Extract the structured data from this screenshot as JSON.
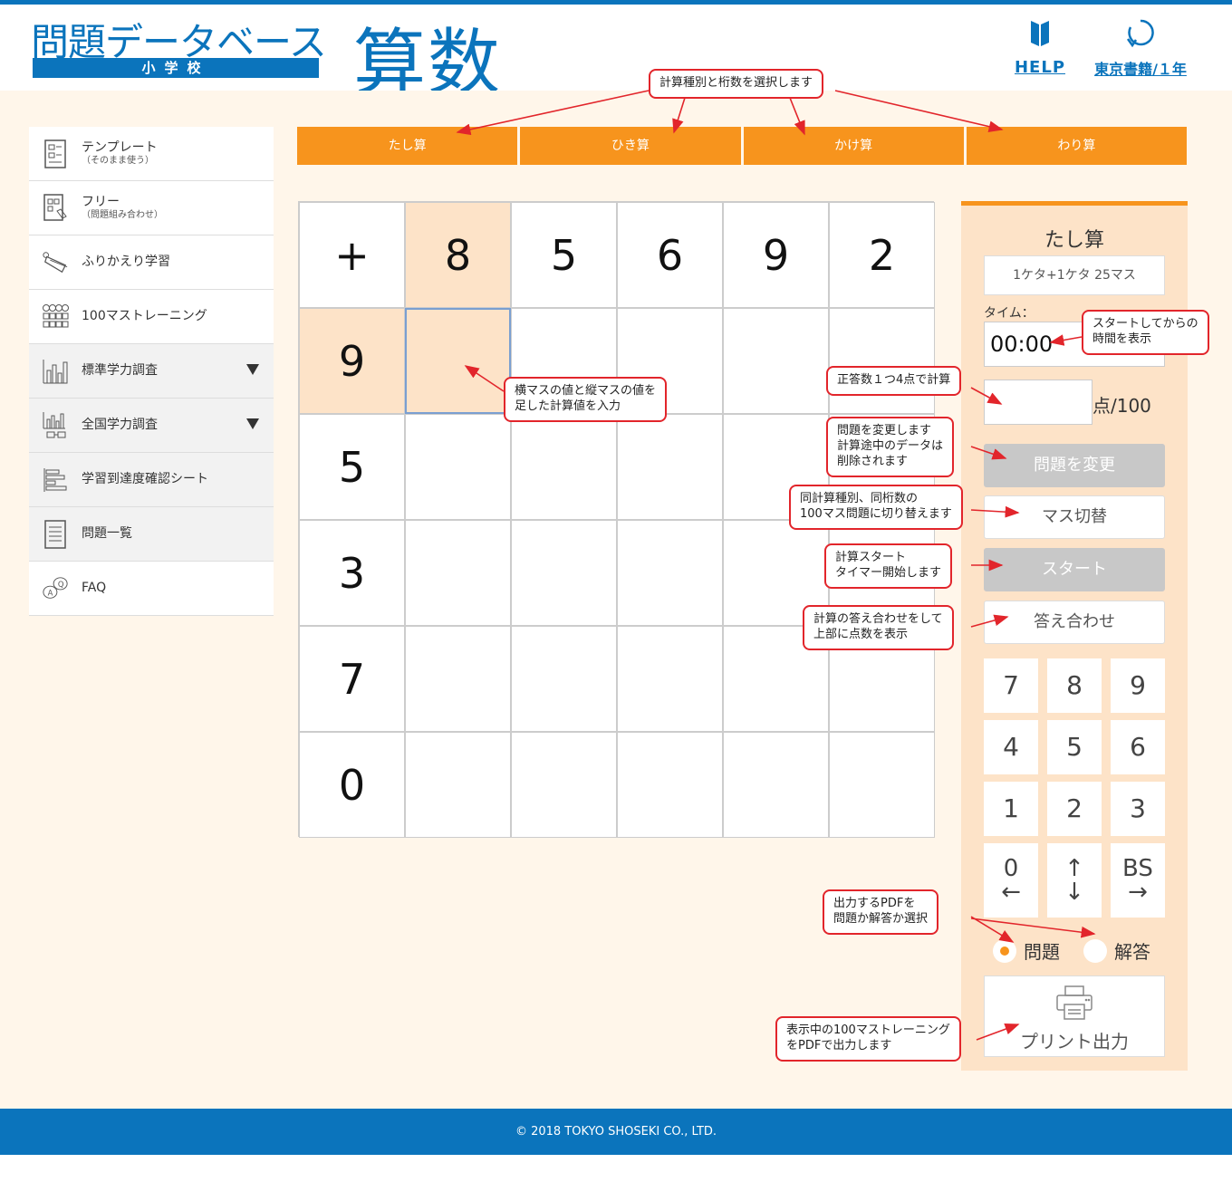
{
  "header": {
    "logo_title": "問題データベース",
    "logo_sub": "小学校",
    "subject": "算数",
    "help_label": "HELP",
    "book_label": "東京書籍/１年"
  },
  "sidebar": {
    "items": [
      {
        "label": "テンプレート",
        "sub": "（そのまま使う）"
      },
      {
        "label": "フリー",
        "sub": "（問題組み合わせ）"
      },
      {
        "label": "ふりかえり学習",
        "sub": ""
      },
      {
        "label": "100マストレーニング",
        "sub": ""
      },
      {
        "label": "標準学力調査",
        "sub": ""
      },
      {
        "label": "全国学力調査",
        "sub": ""
      },
      {
        "label": "学習到達度確認シート",
        "sub": ""
      },
      {
        "label": "問題一覧",
        "sub": ""
      },
      {
        "label": "FAQ",
        "sub": ""
      }
    ]
  },
  "tabs": [
    "たし算",
    "ひき算",
    "かけ算",
    "わり算"
  ],
  "grid": {
    "operator": "+",
    "columns": [
      "8",
      "5",
      "6",
      "9",
      "2"
    ],
    "rows": [
      "9",
      "5",
      "3",
      "7",
      "0"
    ]
  },
  "panel": {
    "title": "たし算",
    "description": "1ケタ+1ケタ 25マス",
    "time_label": "タイム：",
    "time_value": "00:00",
    "score_unit": "点/100",
    "change_button": "問題を変更",
    "switch_button": "マス切替",
    "start_button": "スタート",
    "check_button": "答え合わせ",
    "keys": [
      "7",
      "8",
      "9",
      "4",
      "5",
      "6",
      "1",
      "2",
      "3"
    ],
    "key_zero": "0",
    "key_left": "←",
    "key_up": "↑",
    "key_down": "↓",
    "key_bs": "BS",
    "key_right": "→",
    "radio_question": "問題",
    "radio_answer": "解答",
    "print_button": "プリント出力"
  },
  "callouts": {
    "select_type": "計算種別と桁数を選択します",
    "input_hint_1": "横マスの値と縦マスの値を",
    "input_hint_2": "足した計算値を入力",
    "timer_1": "スタートしてからの",
    "timer_2": "時間を表示",
    "score": "正答数１つ4点で計算",
    "change_1": "問題を変更します",
    "change_2": "計算途中のデータは",
    "change_3": "削除されます",
    "switch_1": "同計算種別、同桁数の",
    "switch_2": "100マス問題に切り替えます",
    "start_1": "計算スタート",
    "start_2": "タイマー開始します",
    "check_1": "計算の答え合わせをして",
    "check_2": "上部に点数を表示",
    "pdf_1": "出力するPDFを",
    "pdf_2": "問題か解答か選択",
    "print_1": "表示中の100マストレーニング",
    "print_2": "をPDFで出力します"
  },
  "footer": {
    "copyright": "© 2018 TOKYO SHOSEKI CO., LTD."
  }
}
